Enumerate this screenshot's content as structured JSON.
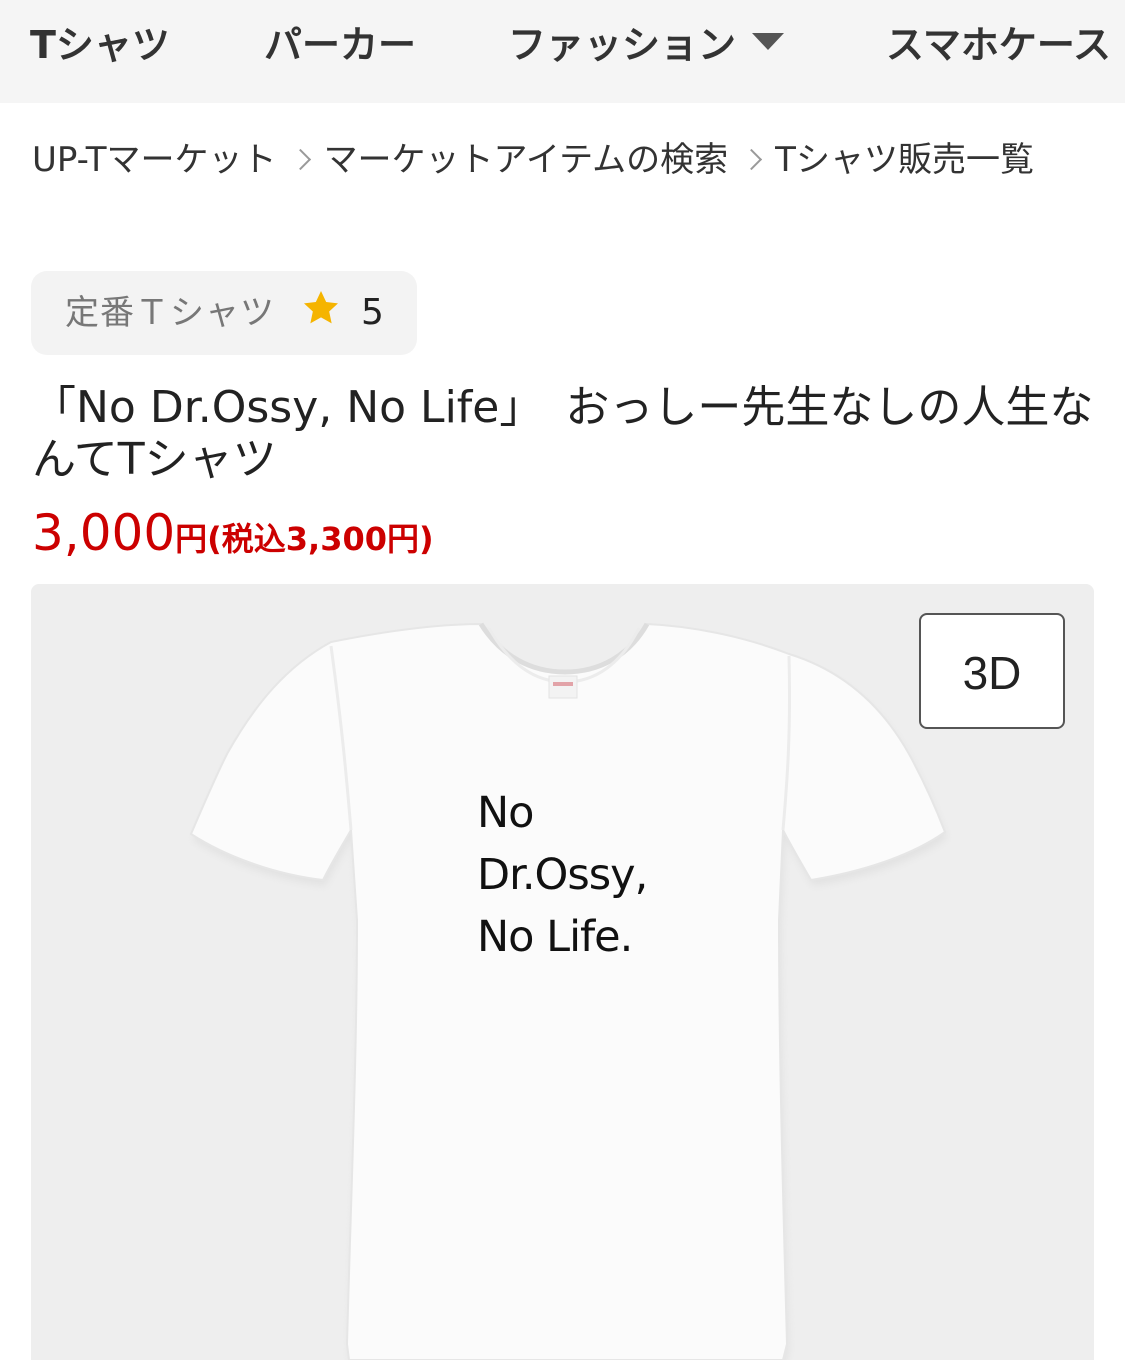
{
  "top_nav": {
    "items": [
      {
        "label": "Tシャツ"
      },
      {
        "label": "パーカー"
      },
      {
        "label": "ファッション",
        "has_dropdown": true
      },
      {
        "label": "スマホケース"
      }
    ],
    "icons": {
      "dropdown": "caret-down-icon"
    }
  },
  "breadcrumb": {
    "items": [
      {
        "label": "UP-Tマーケット"
      },
      {
        "label": "マーケットアイテムの検索"
      },
      {
        "label": "Tシャツ販売一覧"
      }
    ],
    "separator_icon": "chevron-right-icon"
  },
  "product": {
    "type_label": "定番Ｔシャツ",
    "rating_icon": "star-icon",
    "rating": "5",
    "title": "「No Dr.Ossy, No Life」　おっしー先生なしの人生なんてTシャツ",
    "price": "3,000",
    "price_unit": "円",
    "price_tax": "(税込3,300円)",
    "print_text": [
      "No",
      "Dr.Ossy,",
      "No Life."
    ],
    "view_3d_label": "3D"
  },
  "colors": {
    "nav_background": "#f5f5f5",
    "price": "#cc0000",
    "star": "#f5b400",
    "image_background": "#eeeeee"
  }
}
